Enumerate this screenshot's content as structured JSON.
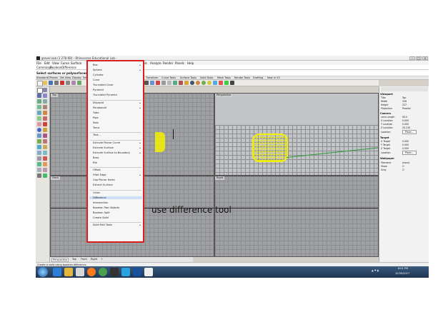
{
  "window": {
    "title": "gravel.sub (1 278 KB) - Rhinoceros Educational Lab -",
    "controls": [
      "–",
      "□",
      "×"
    ]
  },
  "menubar": [
    "File",
    "Edit",
    "View",
    "Curve",
    "Surface",
    "Solid",
    "Mesh",
    "Dimension",
    "Transform",
    "Tools",
    "Analyze",
    "Render",
    "Panels",
    "Help"
  ],
  "command_line": {
    "label": "Command:",
    "value": "_BooleanDifference"
  },
  "prompt": "Select surfaces or polysurfaces to subtract from",
  "toolbar_tabs": [
    "Standard",
    "CPlanes",
    "Set View",
    "Display",
    "Select",
    "Viewport Layout",
    "Visibility",
    "Transform",
    "Curve Tools",
    "Surface Tools",
    "Solid Tools",
    "Mesh Tools",
    "Render Tools",
    "Drafting",
    "New in V5"
  ],
  "viewports": {
    "top_left": "Top",
    "top_right": "Perspective",
    "bottom_left": "Front",
    "bottom_right": "Right"
  },
  "viewport_tabs": [
    "Perspective",
    "Top",
    "Front",
    "Right",
    "+"
  ],
  "status_text": "Create a solid using boolean difference",
  "solid_menu": {
    "items": [
      {
        "label": "Box",
        "sub": true
      },
      {
        "label": "Sphere",
        "sub": true
      },
      {
        "label": "Cylinder",
        "sub": false
      },
      {
        "label": "Cone",
        "sub": false
      },
      {
        "label": "Truncated Cone",
        "sub": false
      },
      {
        "label": "Pyramid",
        "sub": false
      },
      {
        "label": "Truncated Pyramid",
        "sub": false
      },
      {
        "sep": true
      },
      {
        "label": "Ellipsoid",
        "sub": true
      },
      {
        "label": "Paraboloid",
        "sub": true
      },
      {
        "label": "Tube",
        "sub": false
      },
      {
        "label": "Pipe",
        "sub": false
      },
      {
        "label": "Slab",
        "sub": false
      },
      {
        "label": "Torus",
        "sub": false
      },
      {
        "sep": true
      },
      {
        "label": "Text...",
        "sub": false
      },
      {
        "sep": true
      },
      {
        "label": "Extrude Planar Curve",
        "sub": true
      },
      {
        "label": "Extrude Surface",
        "sub": true
      },
      {
        "label": "Extrude Surface to Boundary",
        "sub": true
      },
      {
        "label": "Boss",
        "sub": false
      },
      {
        "label": "Rib",
        "sub": false
      },
      {
        "sep": true
      },
      {
        "label": "Offset",
        "sub": false
      },
      {
        "label": "Fillet Edge",
        "sub": true
      },
      {
        "label": "Cap Planar Holes",
        "sub": false
      },
      {
        "label": "Extract Surface",
        "sub": false
      },
      {
        "sep": true
      },
      {
        "label": "Union",
        "sub": false
      },
      {
        "label": "Difference",
        "sub": false,
        "highlight": true
      },
      {
        "label": "Intersection",
        "sub": false
      },
      {
        "label": "Boolean Two Objects",
        "sub": false
      },
      {
        "label": "Boolean Split",
        "sub": false
      },
      {
        "label": "Create Solid",
        "sub": false
      },
      {
        "sep": true
      },
      {
        "label": "Solid Edit Tools",
        "sub": true
      }
    ]
  },
  "properties": {
    "viewport_head": "Viewport",
    "viewport_rows": [
      {
        "k": "Title",
        "v": "Top"
      },
      {
        "k": "Width",
        "v": "326"
      },
      {
        "k": "Height",
        "v": "227"
      },
      {
        "k": "Projection",
        "v": "Parallel"
      }
    ],
    "camera_head": "Camera",
    "camera_rows": [
      {
        "k": "Lens Length",
        "v": "50.0"
      },
      {
        "k": "X Location",
        "v": "0.000"
      },
      {
        "k": "Y Location",
        "v": "0.000"
      },
      {
        "k": "Z Location",
        "v": "20.210"
      },
      {
        "k": "Location",
        "v": "Place..."
      }
    ],
    "target_head": "Target",
    "target_rows": [
      {
        "k": "X Target",
        "v": "0.000"
      },
      {
        "k": "Y Target",
        "v": "0.000"
      },
      {
        "k": "Z Target",
        "v": "0.000"
      },
      {
        "k": "Location",
        "v": "Place..."
      }
    ],
    "wallpaper_head": "Wallpaper",
    "wallpaper_rows": [
      {
        "k": "Filename",
        "v": "(none)"
      },
      {
        "k": "Show",
        "v": "☑"
      },
      {
        "k": "Gray",
        "v": "☑"
      }
    ]
  },
  "taskbar": {
    "time": "8:01 PM",
    "date": "10/30/2017"
  },
  "annotation": "use difference tool",
  "colors": {
    "menu_border": "#d81e1e",
    "viewport_bg": "#9fa0a2",
    "object_yellow": "#f3f000",
    "taskbar": "#2c4766",
    "highlight": "#cfe0f6"
  }
}
